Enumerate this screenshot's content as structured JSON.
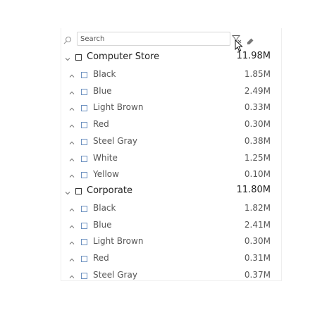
{
  "search": {
    "placeholder": "Search"
  },
  "icons": {
    "search": "search-icon",
    "filter": "filter-icon",
    "eraser": "eraser-icon",
    "cursor": "mouse-pointer-icon",
    "expanded": "chevron-down-icon",
    "collapsed": "chevron-up-icon"
  },
  "colors": {
    "text_primary": "#222222",
    "text_secondary": "#555555",
    "checkbox_child_border": "#6a8fbf"
  },
  "groups": [
    {
      "label": "Computer Store",
      "value": "11.98M",
      "items": [
        {
          "label": "Black",
          "value": "1.85M"
        },
        {
          "label": "Blue",
          "value": "2.49M"
        },
        {
          "label": "Light Brown",
          "value": "0.33M"
        },
        {
          "label": "Red",
          "value": "0.30M"
        },
        {
          "label": "Steel Gray",
          "value": "0.38M"
        },
        {
          "label": "White",
          "value": "1.25M"
        },
        {
          "label": "Yellow",
          "value": "0.10M"
        }
      ]
    },
    {
      "label": "Corporate",
      "value": "11.80M",
      "items": [
        {
          "label": "Black",
          "value": "1.82M"
        },
        {
          "label": "Blue",
          "value": "2.41M"
        },
        {
          "label": "Light Brown",
          "value": "0.30M"
        },
        {
          "label": "Red",
          "value": "0.31M"
        },
        {
          "label": "Steel Gray",
          "value": "0.37M"
        }
      ]
    }
  ]
}
